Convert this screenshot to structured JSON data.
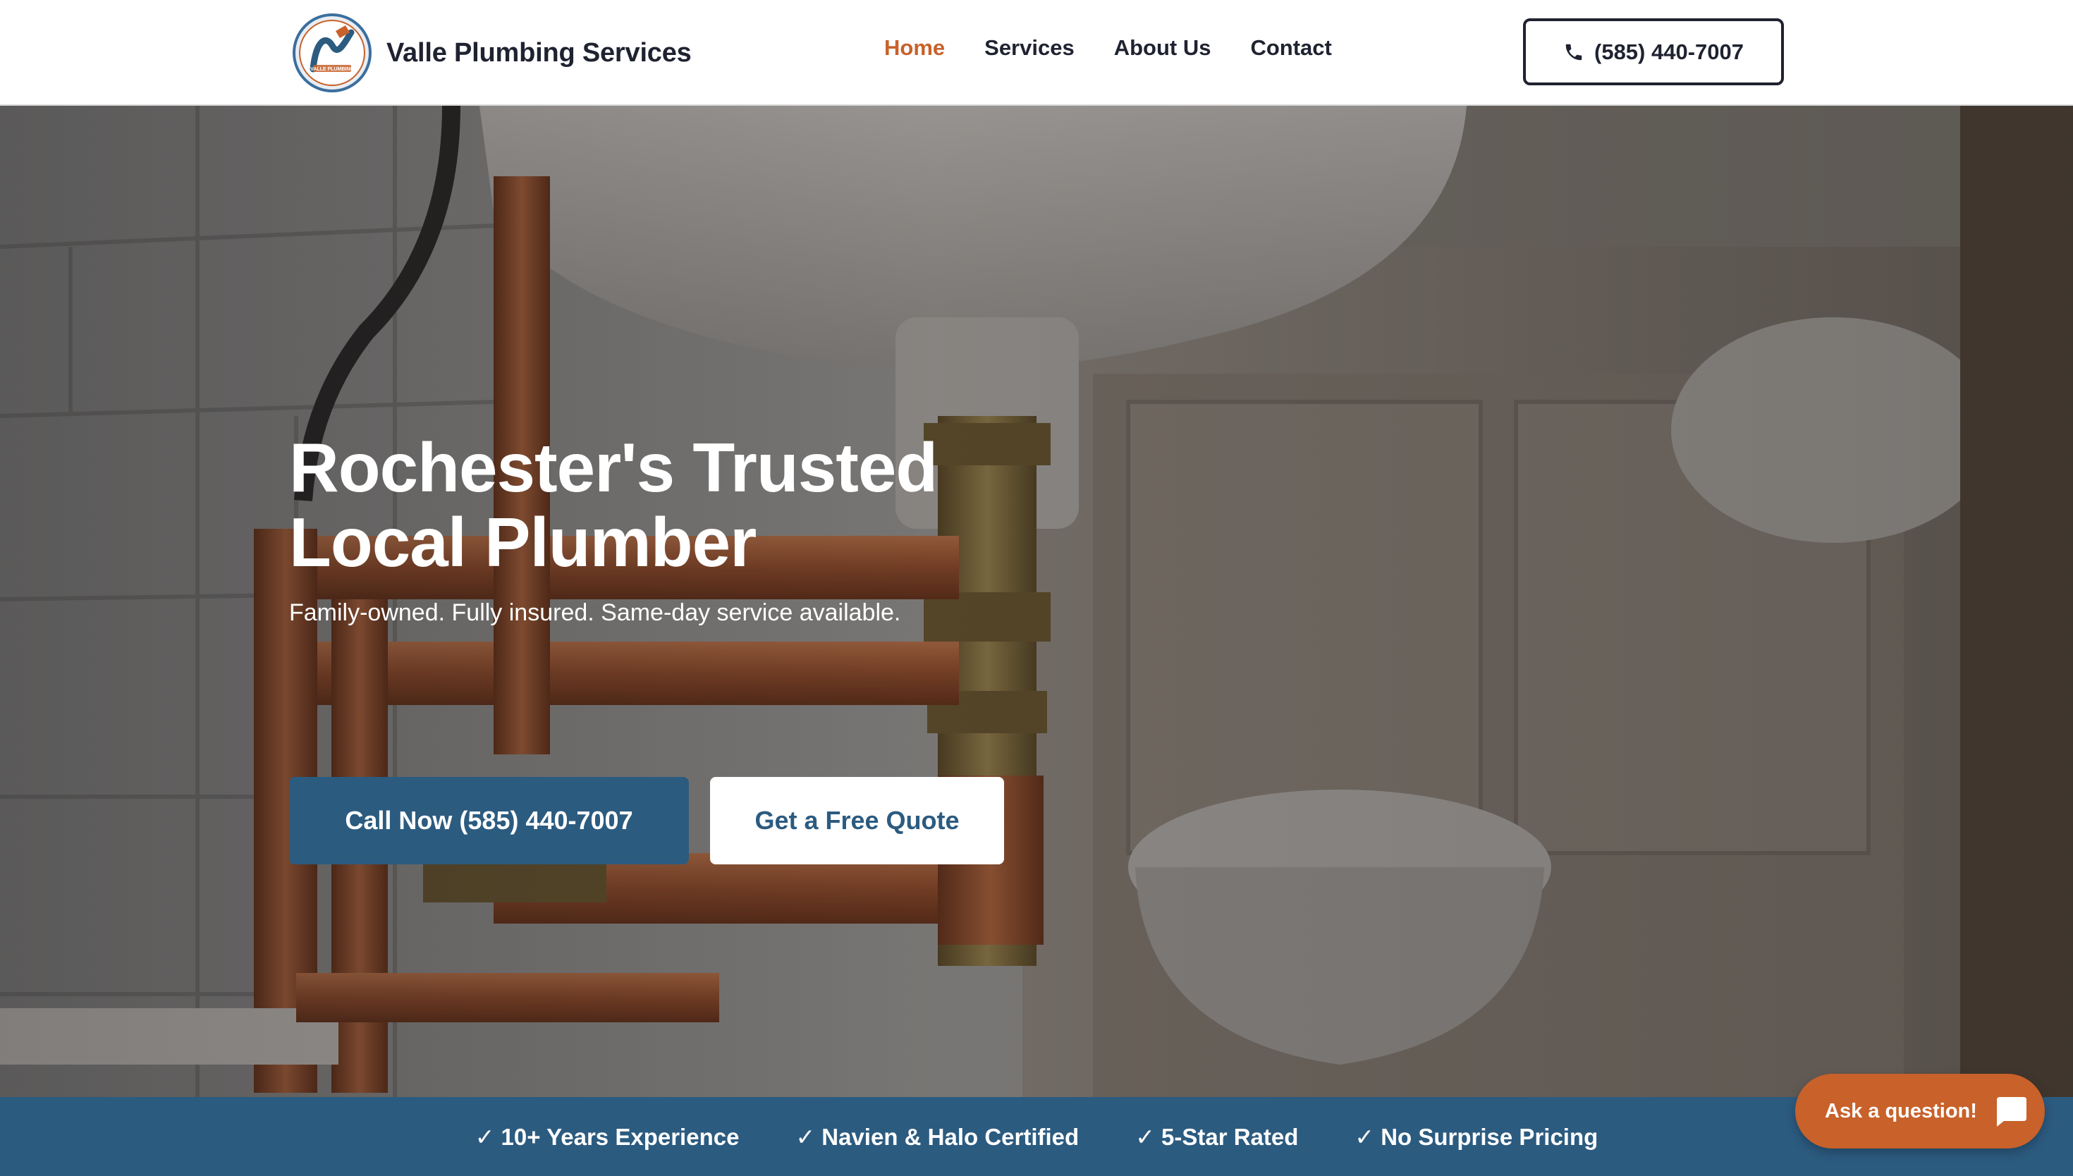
{
  "header": {
    "brand_name": "Valle Plumbing Services",
    "logo_text": "VALLE PLUMBING",
    "nav": [
      {
        "label": "Home",
        "active": true
      },
      {
        "label": "Services",
        "active": false
      },
      {
        "label": "About Us",
        "active": false
      },
      {
        "label": "Contact",
        "active": false
      }
    ],
    "phone_label": "(585) 440-7007",
    "phone_icon": "phone-icon"
  },
  "hero": {
    "title_line1": "Rochester's Trusted",
    "title_line2": "Local Plumber",
    "subtitle": "Family-owned. Fully insured. Same-day service available.",
    "cta_primary": "Call Now (585) 440-7007",
    "cta_secondary": "Get a Free Quote"
  },
  "trust_bar": [
    "✓ 10+ Years Experience",
    "✓ Navien & Halo Certified",
    "✓ 5-Star Rated",
    "✓ No Surprise Pricing"
  ],
  "chat": {
    "label": "Ask a question!",
    "icon": "chat-bubble-icon"
  },
  "colors": {
    "accent": "#c8612a",
    "brand_blue": "#2c5b80",
    "text_dark": "#1f2230"
  }
}
